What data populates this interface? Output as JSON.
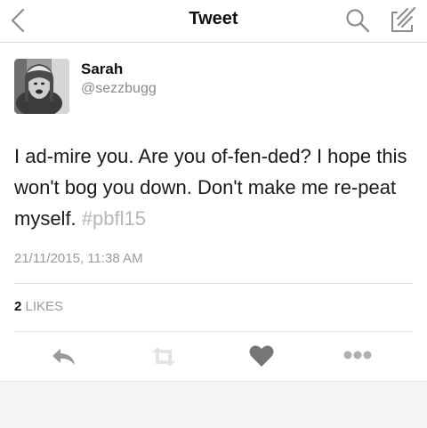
{
  "navbar": {
    "title": "Tweet",
    "back_icon": "chevron-left-icon",
    "search_icon": "search-icon",
    "compose_icon": "compose-icon"
  },
  "user": {
    "name": "Sarah",
    "handle": "@sezzbugg"
  },
  "tweet": {
    "text": "I ad-mire you. Are you of-fen-ded? I hope this won't bog you down. Don't make me re-peat myself.",
    "hashtag": "#pbfl15",
    "timestamp": "21/11/2015, 11:38 AM"
  },
  "stats": {
    "likes_count": "2",
    "likes_label": "LIKES"
  },
  "actions": [
    "reply-icon",
    "retweet-icon",
    "heart-icon",
    "more-icon"
  ],
  "colors": {
    "text": "#1a1a1a",
    "muted": "#9b9b9b",
    "hashtag": "#b6b6b6",
    "divider": "#e2e2e2"
  }
}
